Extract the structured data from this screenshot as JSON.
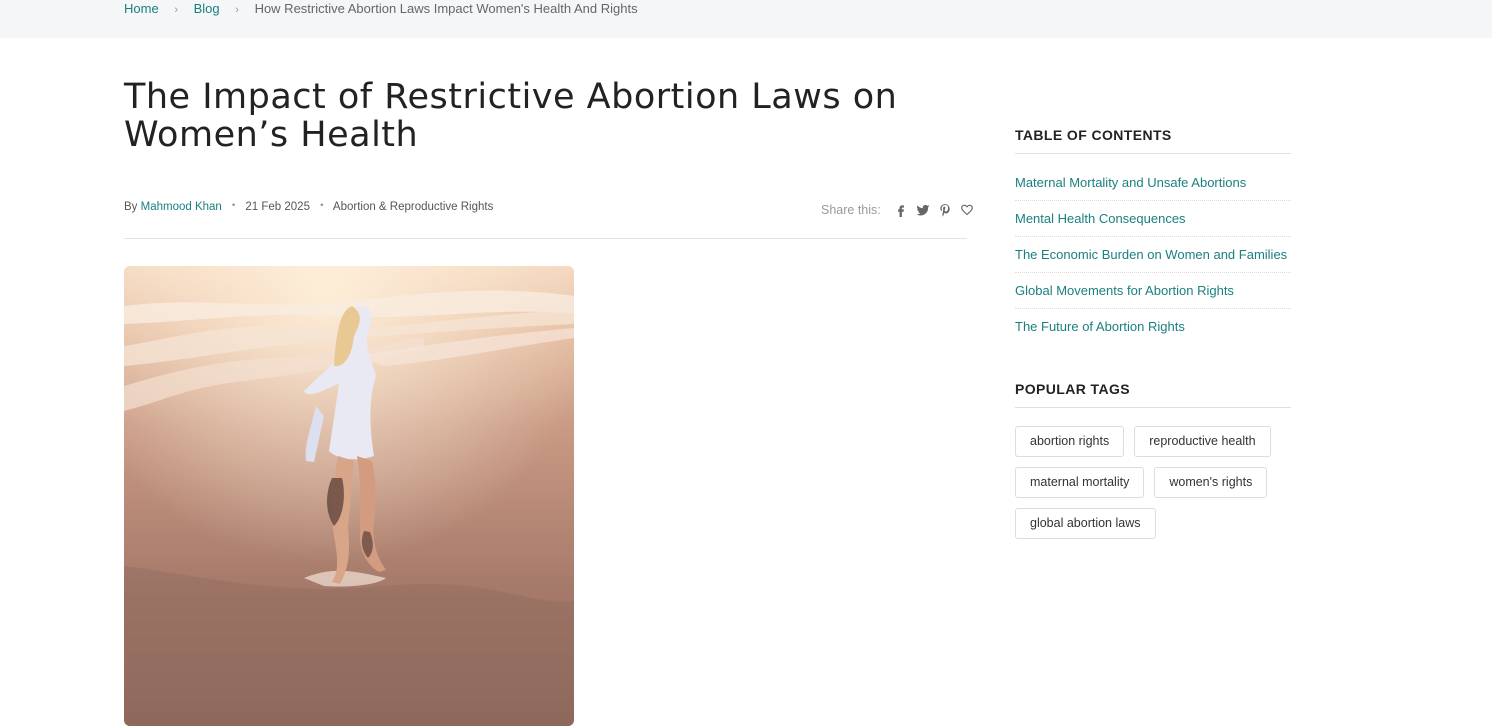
{
  "breadcrumb": {
    "home": "Home",
    "blog": "Blog",
    "current": "How Restrictive Abortion Laws Impact Women's Health And Rights",
    "separator": "›"
  },
  "article": {
    "title": "The Impact of Restrictive Abortion Laws on Women’s Health",
    "by_label": "By",
    "author": "Mahmood Khan",
    "date": "21 Feb 2025",
    "category": "Abortion & Reproductive Rights",
    "meta_separator": "•"
  },
  "share": {
    "label": "Share this:",
    "icons": [
      "facebook-icon",
      "twitter-icon",
      "pinterest-icon",
      "heart-icon"
    ]
  },
  "sidebar": {
    "toc_heading": "TABLE OF CONTENTS",
    "toc_items": [
      "Maternal Mortality and Unsafe Abortions",
      "Mental Health Consequences",
      "The Economic Burden on Women and Families",
      "Global Movements for Abortion Rights",
      "The Future of Abortion Rights"
    ],
    "tags_heading": "POPULAR TAGS",
    "tags": [
      "abortion rights",
      "reproductive health",
      "maternal mortality",
      "women's rights",
      "global abortion laws"
    ]
  },
  "colors": {
    "link": "#1b7f7f",
    "heading": "#222222",
    "breadcrumb_bg": "#f5f6f7"
  }
}
